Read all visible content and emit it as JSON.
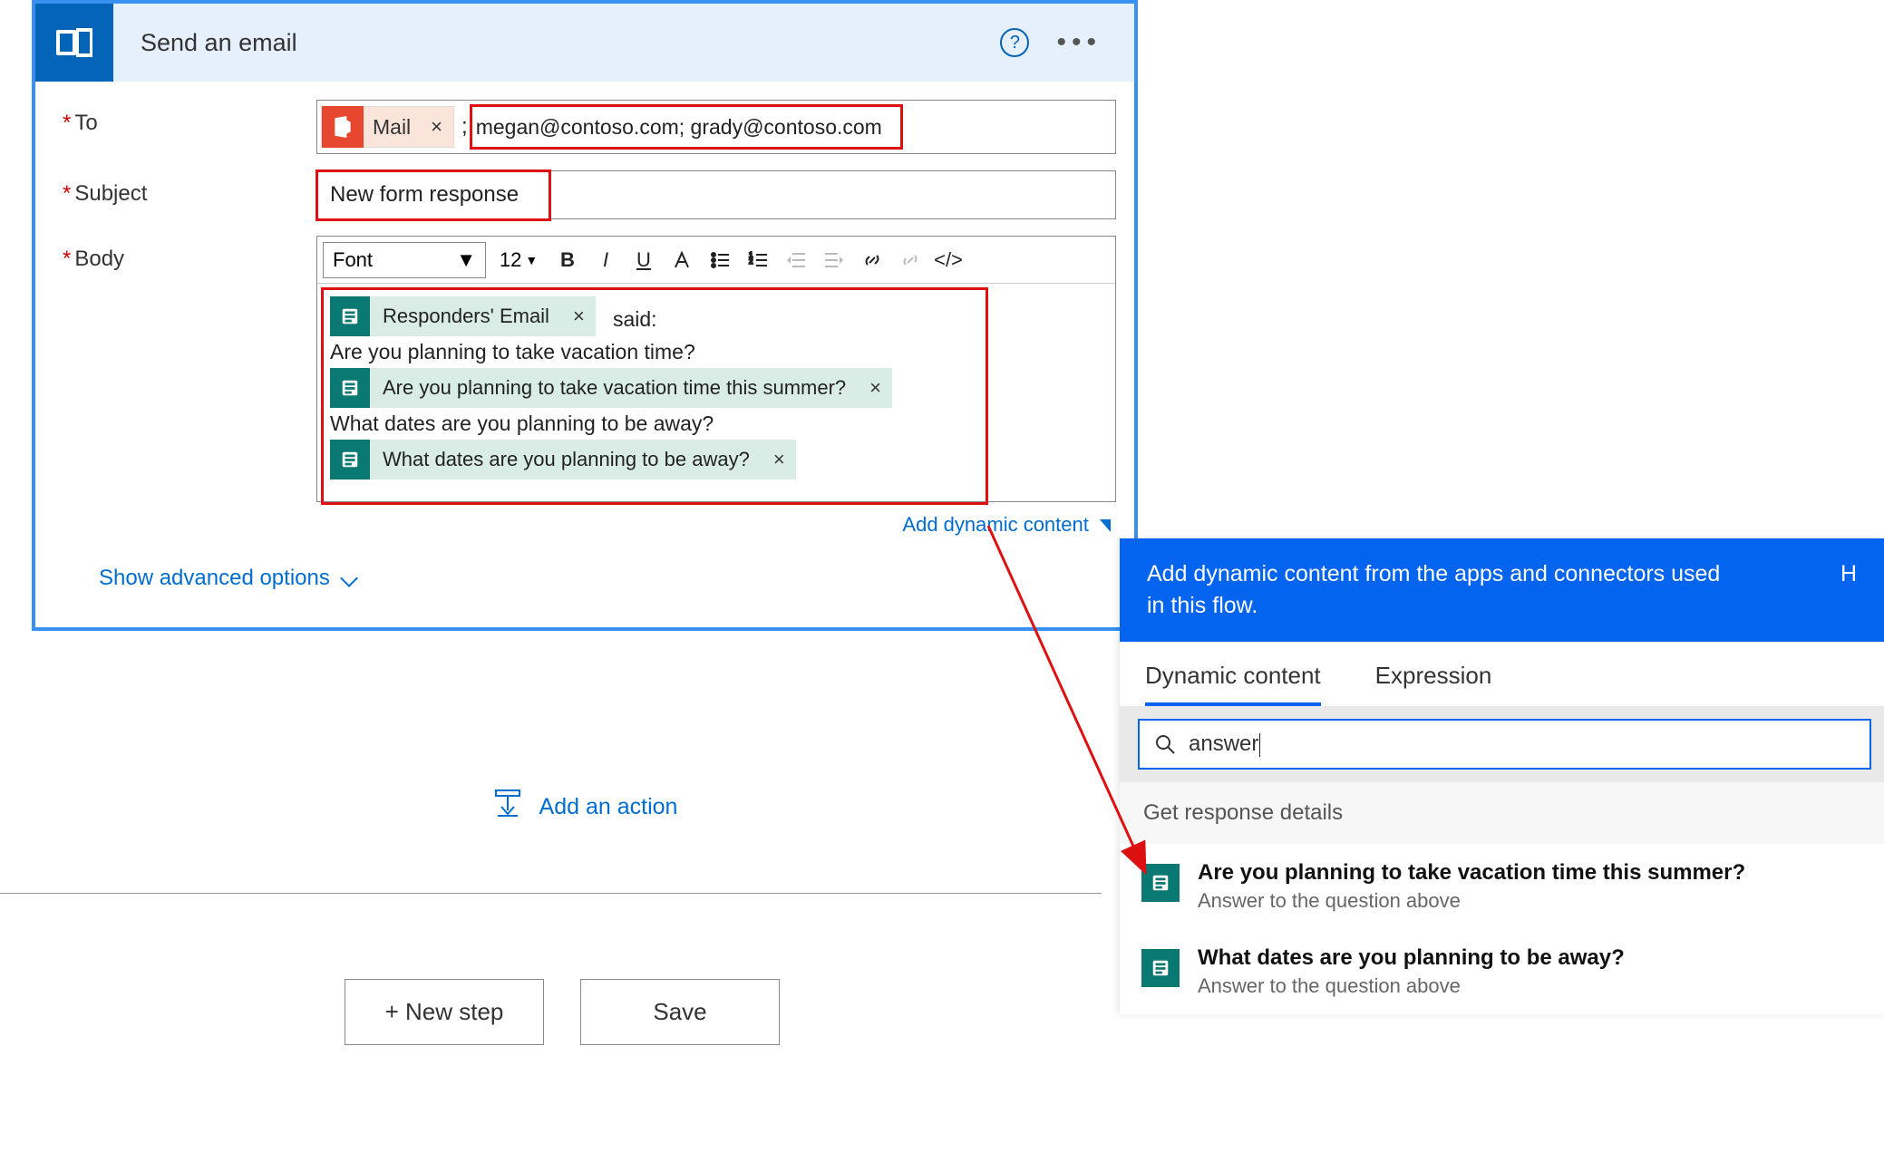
{
  "card": {
    "title": "Send an email",
    "to_label": "To",
    "subject_label": "Subject",
    "body_label": "Body",
    "advanced_options": "Show advanced options",
    "add_dynamic_content": "Add dynamic content"
  },
  "to": {
    "token_label": "Mail",
    "emails": "megan@contoso.com; grady@contoso.com"
  },
  "subject": {
    "value": "New form response"
  },
  "toolbar": {
    "font_label": "Font",
    "font_size": "12"
  },
  "body": {
    "said_text": "said:",
    "token_responders": "Responders' Email",
    "line1": "Are you planning to take vacation time?",
    "token_q1": "Are you planning to take vacation time this summer?",
    "line2": "What dates are you planning to be away?",
    "token_q2": "What dates are you planning to be away?"
  },
  "actions": {
    "add_action": "Add an action",
    "new_step": "+ New step",
    "save": "Save"
  },
  "dyn": {
    "header": "Add dynamic content from the apps and connectors used in this flow.",
    "header_right": "H",
    "tab_dynamic": "Dynamic content",
    "tab_expression": "Expression",
    "search_value": "answer",
    "section_title": "Get response details",
    "items": [
      {
        "title": "Are you planning to take vacation time this summer?",
        "sub": "Answer to the question above"
      },
      {
        "title": "What dates are you planning to be away?",
        "sub": "Answer to the question above"
      }
    ]
  }
}
